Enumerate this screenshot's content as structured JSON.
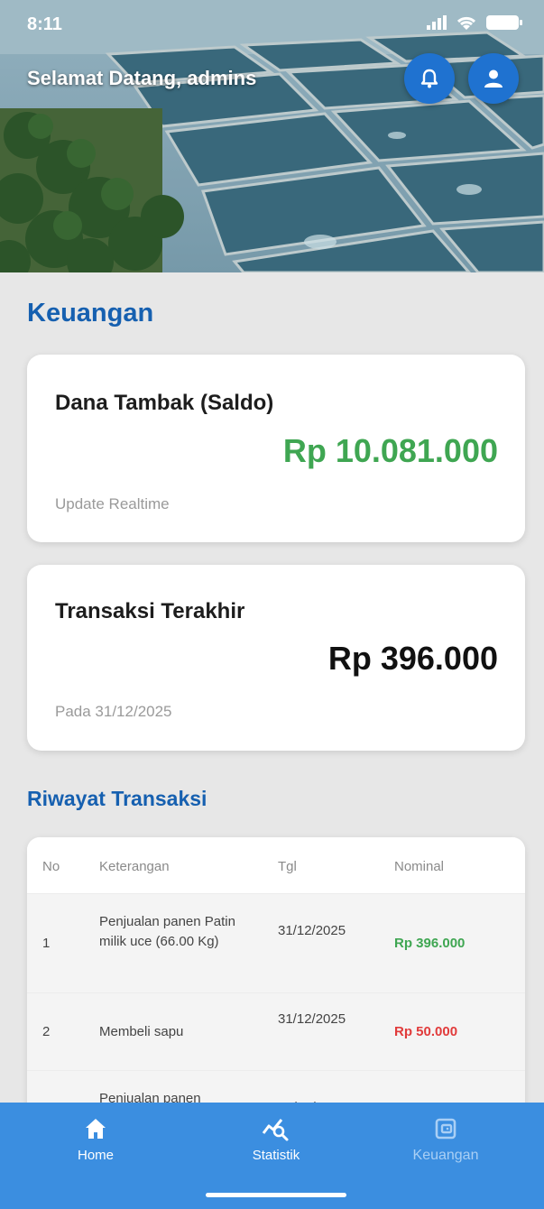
{
  "status_bar": {
    "time": "8:11"
  },
  "header": {
    "welcome_text": "Selamat Datang, admins"
  },
  "icons": {
    "notification": "bell-icon",
    "profile": "user-icon",
    "home": "home-icon",
    "statistik": "chart-search-icon",
    "keuangan": "wallet-icon"
  },
  "colors": {
    "primary": "#1f72d0",
    "title_blue": "#1660b0",
    "positive": "#3fa652",
    "negative": "#e13b3b",
    "nav_bg": "#3b8ee0"
  },
  "keuangan": {
    "title": "Keuangan",
    "saldo_card": {
      "label": "Dana Tambak (Saldo)",
      "amount": "Rp 10.081.000",
      "subtitle": "Update Realtime"
    },
    "last_transaction_card": {
      "label": "Transaksi Terakhir",
      "amount": "Rp 396.000",
      "subtitle": "Pada 31/12/2025"
    }
  },
  "history": {
    "title": "Riwayat Transaksi",
    "columns": [
      "No",
      "Keterangan",
      "Tgl",
      "Nominal"
    ],
    "rows": [
      {
        "no": "1",
        "keterangan": "Penjualan panen Patin milik uce (66.00 Kg)",
        "tgl": "31/12/2025",
        "nominal": "Rp 396.000",
        "type": "income"
      },
      {
        "no": "2",
        "keterangan": "Membeli sapu",
        "tgl": "31/12/2025",
        "nominal": "Rp 50.000",
        "type": "expense"
      },
      {
        "no": "",
        "keterangan": "Penjualan panen",
        "tgl": "31/12/202",
        "nominal": "",
        "type": "income"
      }
    ]
  },
  "bottom_nav": {
    "items": [
      {
        "label": "Home"
      },
      {
        "label": "Statistik"
      },
      {
        "label": "Keuangan"
      }
    ]
  }
}
